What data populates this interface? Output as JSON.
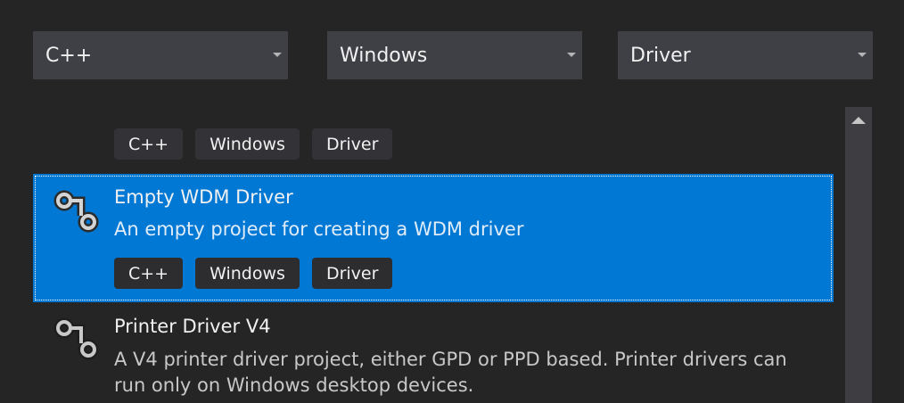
{
  "filters": {
    "language": "C++",
    "platform": "Windows",
    "project_type": "Driver"
  },
  "templates": [
    {
      "title": "",
      "description": "",
      "tags": [
        "C++",
        "Windows",
        "Driver"
      ]
    },
    {
      "title": "Empty WDM Driver",
      "description": "An empty project for creating a WDM driver",
      "tags": [
        "C++",
        "Windows",
        "Driver"
      ],
      "selected": true
    },
    {
      "title": "Printer Driver V4",
      "description": "A V4 printer driver project, either GPD or PPD based. Printer drivers can run only on Windows desktop devices.",
      "tags": []
    }
  ],
  "icons": {
    "template_icon": "driver-connector-icon",
    "scroll_up": "triangle-up-icon",
    "dropdown": "chevron-down-icon"
  },
  "colors": {
    "background": "#252526",
    "combo_background": "#3f3f46",
    "selection": "#0078d4",
    "tag_background": "#333337",
    "scrollbar": "#3e3e42"
  }
}
